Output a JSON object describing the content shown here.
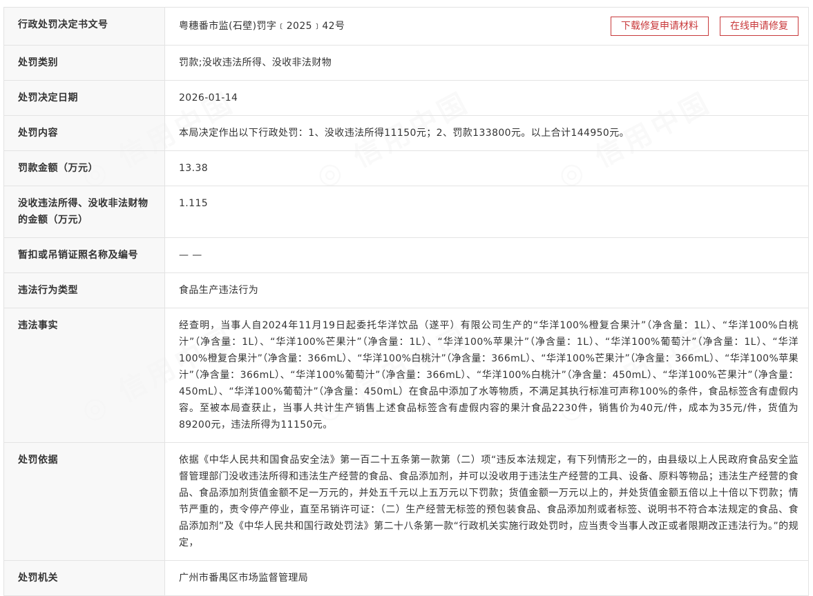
{
  "actions": {
    "download_label": "下载修复申请材料",
    "online_label": "在线申请修复"
  },
  "rows": [
    {
      "label": "行政处罚决定书文号",
      "value": "粤穗番市监(石壁)罚字﹝2025﹞42号"
    },
    {
      "label": "处罚类别",
      "value": "罚款;没收违法所得、没收非法财物"
    },
    {
      "label": "处罚决定日期",
      "value": "2026-01-14"
    },
    {
      "label": "处罚内容",
      "value": "本局决定作出以下行政处罚：1、没收违法所得11150元；2、罚款133800元。以上合计144950元。"
    },
    {
      "label": "罚款金额（万元）",
      "value": "13.38"
    },
    {
      "label": "没收违法所得、没收非法财物的金额（万元）",
      "value": "1.115"
    },
    {
      "label": "暂扣或吊销证照名称及编号",
      "value": "— —"
    },
    {
      "label": "违法行为类型",
      "value": "食品生产违法行为"
    },
    {
      "label": "违法事实",
      "value": "经查明，当事人自2024年11月19日起委托华洋饮品（遂平）有限公司生产的“华洋100%橙复合果汁”（净含量：1L）、“华洋100%白桃汁”（净含量：1L）、“华洋100%芒果汁”（净含量：1L）、“华洋100%苹果汁”（净含量：1L）、“华洋100%葡萄汁”（净含量：1L）、“华洋100%橙复合果汁”（净含量：366mL）、“华洋100%白桃汁”（净含量：366mL）、“华洋100%芒果汁”（净含量：366mL）、“华洋100%苹果汁”（净含量：366mL）、“华洋100%葡萄汁”（净含量：366mL）、“华洋100%白桃汁”（净含量：450mL）、“华洋100%芒果汁”（净含量：450mL）、“华洋100%葡萄汁”（净含量：450mL）在食品中添加了水等物质，不满足其执行标准可声称100%的条件，食品标签含有虚假内容。至被本局查获止，当事人共计生产销售上述食品标签含有虚假内容的果汁食品2230件，销售价为40元/件，成本为35元/件，货值为89200元，违法所得为11150元。"
    },
    {
      "label": "处罚依据",
      "value": "依据《中华人民共和国食品安全法》第一百二十五条第一款第（二）项“违反本法规定，有下列情形之一的，由县级以上人民政府食品安全监督管理部门没收违法所得和违法生产经营的食品、食品添加剂，并可以没收用于违法生产经营的工具、设备、原料等物品；违法生产经营的食品、食品添加剂货值金额不足一万元的，并处五千元以上五万元以下罚款；货值金额一万元以上的，并处货值金额五倍以上十倍以下罚款；情节严重的，责令停产停业，直至吊销许可证：（二）生产经营无标签的预包装食品、食品添加剂或者标签、说明书不符合本法规定的食品、食品添加剂”及《中华人民共和国行政处罚法》第二十八条第一款“行政机关实施行政处罚时，应当责令当事人改正或者限期改正违法行为。”的规定，"
    },
    {
      "label": "处罚机关",
      "value": "广州市番禺区市场监督管理局"
    }
  ]
}
